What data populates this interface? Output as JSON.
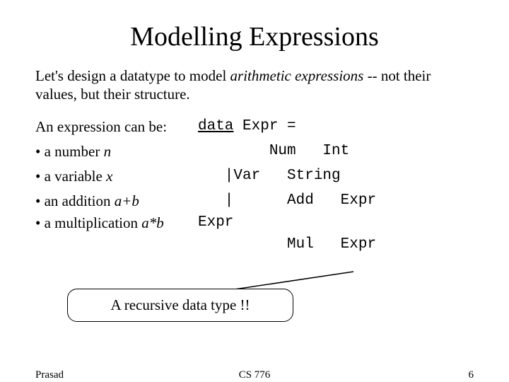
{
  "title": "Modelling Expressions",
  "intro": {
    "pre": "Let's design a datatype to model ",
    "em": "arithmetic expressions",
    "post": " -- not their values, but their structure."
  },
  "lead": "An expression can be:",
  "code_head": "data Expr =",
  "bullets": {
    "b1": {
      "text": "a number ",
      "var": "n"
    },
    "b2": {
      "text": "a variable ",
      "var": "x"
    },
    "b3": {
      "text": "an addition ",
      "var": "a+b"
    },
    "b4": {
      "text": "a multiplication ",
      "var": "a*b"
    }
  },
  "code": {
    "c1": "        Num   Int",
    "c2": "   |Var   String",
    "c3": "   |      Add   Expr",
    "c4": "Expr",
    "c5": "          Mul   Expr"
  },
  "callout": "A recursive data type !!",
  "footer": {
    "left": "Prasad",
    "center": "CS 776",
    "right": "6"
  }
}
